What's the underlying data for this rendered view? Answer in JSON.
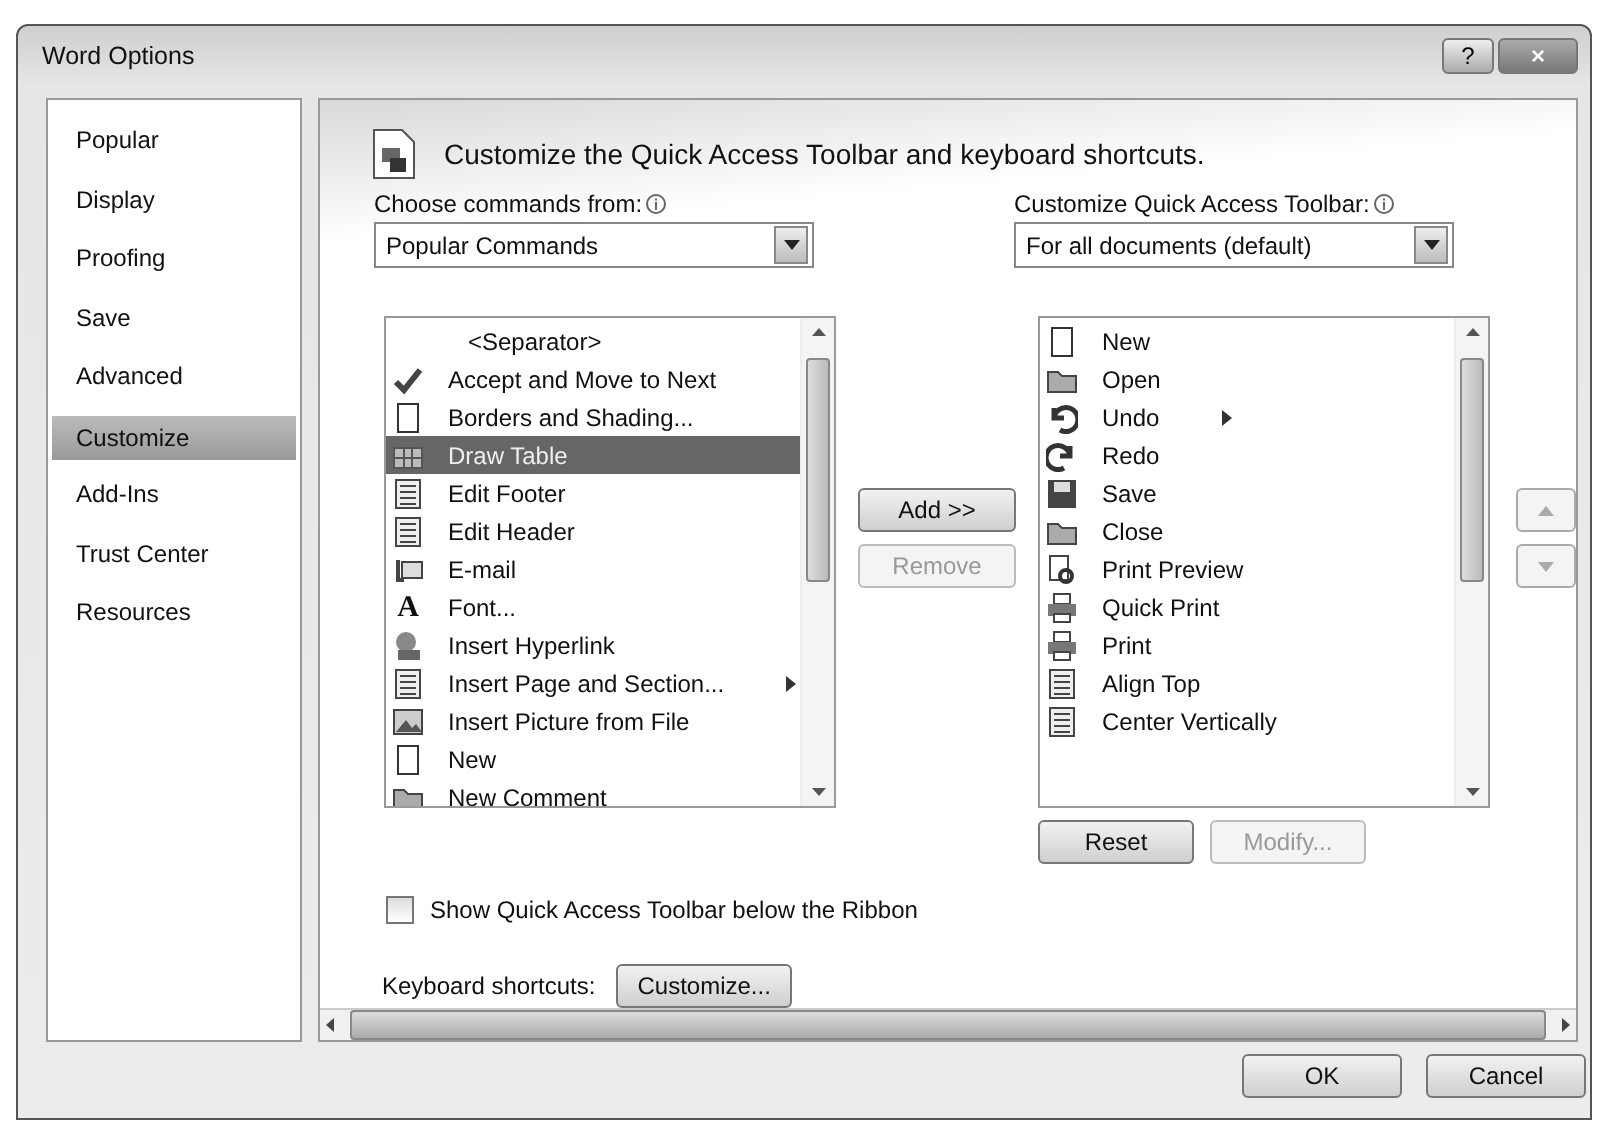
{
  "window": {
    "title": "Word Options",
    "buttons": [
      {
        "kind": "help",
        "label": "?"
      },
      {
        "kind": "close",
        "label": "×"
      }
    ]
  },
  "sidebar": {
    "items": [
      {
        "label": "Popular",
        "selected": false
      },
      {
        "label": "Display",
        "selected": false
      },
      {
        "label": "Proofing",
        "selected": false
      },
      {
        "label": "Save",
        "selected": false
      },
      {
        "label": "Advanced",
        "selected": false
      },
      {
        "label": "Customize",
        "selected": true
      },
      {
        "label": "Add-Ins",
        "selected": false
      },
      {
        "label": "Trust Center",
        "selected": false
      },
      {
        "label": "Resources",
        "selected": false
      }
    ]
  },
  "header": {
    "title": "Customize the Quick Access Toolbar and keyboard shortcuts."
  },
  "commands_from": {
    "label": "Choose commands from:",
    "value": "Popular Commands"
  },
  "toolbar_for": {
    "label": "Customize Quick Access Toolbar:",
    "value": "For all documents (default)"
  },
  "commands": [
    {
      "label": "<Separator>",
      "selected": false,
      "submenu": false
    },
    {
      "label": "Accept and Move to Next",
      "selected": false,
      "submenu": false
    },
    {
      "label": "Borders and Shading...",
      "selected": false,
      "submenu": false
    },
    {
      "label": "Draw Table",
      "selected": true,
      "submenu": false
    },
    {
      "label": "Edit Footer",
      "selected": false,
      "submenu": false
    },
    {
      "label": "Edit Header",
      "selected": false,
      "submenu": false
    },
    {
      "label": "E-mail",
      "selected": false,
      "submenu": false
    },
    {
      "label": "Font...",
      "selected": false,
      "submenu": false,
      "glyph": "A"
    },
    {
      "label": "Insert Hyperlink",
      "selected": false,
      "submenu": false
    },
    {
      "label": "Insert Page and Section...",
      "selected": false,
      "submenu": true
    },
    {
      "label": "Insert Picture from File",
      "selected": false,
      "submenu": false
    },
    {
      "label": "New",
      "selected": false,
      "submenu": false
    },
    {
      "label": "New Comment",
      "selected": false,
      "submenu": false
    }
  ],
  "move_buttons": [
    {
      "label": "Add >>",
      "disabled": false
    },
    {
      "label": "Remove",
      "disabled": true
    }
  ],
  "toolbar_items": [
    {
      "label": "New",
      "selected": false,
      "submenu": false
    },
    {
      "label": "Open",
      "selected": false,
      "submenu": false
    },
    {
      "label": "Undo",
      "selected": false,
      "submenu": true
    },
    {
      "label": "Redo",
      "selected": false,
      "submenu": false
    },
    {
      "label": "Save",
      "selected": false,
      "submenu": false
    },
    {
      "label": "Close",
      "selected": false,
      "submenu": false
    },
    {
      "label": "Print Preview",
      "selected": false,
      "submenu": false
    },
    {
      "label": "Quick Print",
      "selected": false,
      "submenu": false
    },
    {
      "label": "Print",
      "selected": false,
      "submenu": false
    },
    {
      "label": "Align Top",
      "selected": false,
      "submenu": false
    },
    {
      "label": "Center Vertically",
      "selected": false,
      "submenu": false
    }
  ],
  "order_buttons": [
    {
      "kind": "up",
      "disabled": true
    },
    {
      "kind": "down",
      "disabled": true
    }
  ],
  "toolbar_buttons": [
    {
      "label": "Reset",
      "disabled": false
    },
    {
      "label": "Modify...",
      "disabled": true
    }
  ],
  "show_below_ribbon": {
    "label": "Show Quick Access Toolbar below the Ribbon",
    "checked": false
  },
  "keyboard": {
    "label": "Keyboard shortcuts:",
    "button": "Customize..."
  },
  "footer_buttons": [
    {
      "label": "OK"
    },
    {
      "label": "Cancel"
    }
  ]
}
